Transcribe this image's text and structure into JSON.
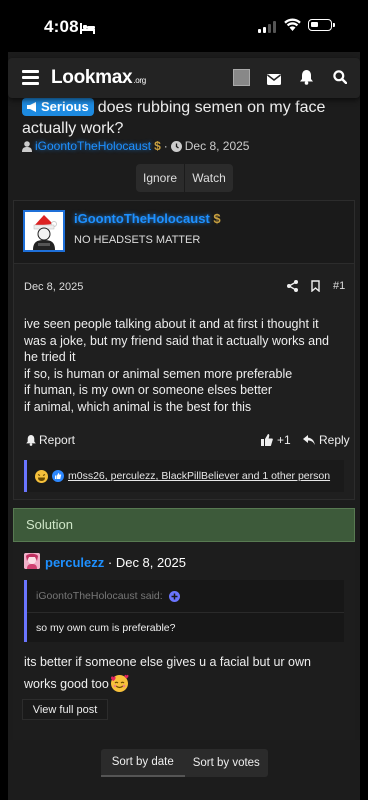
{
  "status": {
    "time": "4:08"
  },
  "header": {
    "logo": "Lookmax",
    "logo_suffix": ".org"
  },
  "thread": {
    "prefix": "Serious",
    "title": "does rubbing semen on my face actually work?",
    "author": "iGoontoTheHolocaust",
    "date": "Dec 8, 2025",
    "ignore_label": "Ignore",
    "watch_label": "Watch"
  },
  "post": {
    "username": "iGoontoTheHolocaust",
    "user_title": "NO HEADSETS MATTER",
    "date": "Dec 8, 2025",
    "number": "#1",
    "body_lines": [
      "ive seen people talking about it and at first i thought it",
      "was a joke, but my friend said that it actually works and",
      "he tried it",
      "if so, is human or animal semen more preferable",
      "if human, is my own or someone elses better",
      "if animal, which animal is the best for this"
    ],
    "report_label": "Report",
    "like_count": "+1",
    "reply_label": "Reply",
    "reactions_text": "m0ss26, perculezz, BlackPillBeliever and 1 other person"
  },
  "solution": {
    "label": "Solution",
    "username": "perculezz",
    "date": "Dec 8, 2025",
    "quote_attribution": "iGoontoTheHolocaust said:",
    "quote_text": "so my own cum is preferable?",
    "text_line1": "its better if someone else gives u a facial but ur own",
    "text_line2": "works good too",
    "view_full_label": "View full post"
  },
  "sort": {
    "by_date": "Sort by date",
    "by_votes": "Sort by votes"
  },
  "colors": {
    "accent_blue": "#1e90ff",
    "solution_green": "#3d5a3a",
    "quote_bar": "#6a75ff",
    "dollar_gold": "#c8a040"
  }
}
